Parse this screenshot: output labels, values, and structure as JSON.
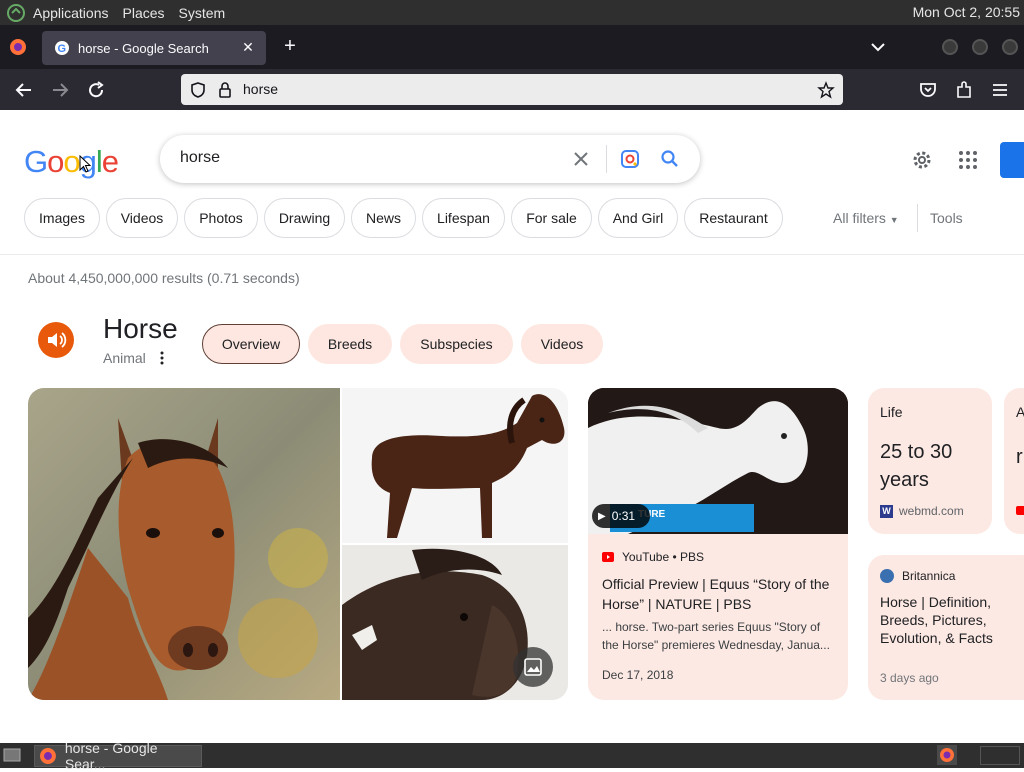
{
  "top_panel": {
    "menus": [
      "Applications",
      "Places",
      "System"
    ],
    "clock": "Mon Oct  2, 20:55"
  },
  "browser": {
    "tab_title": "horse - Google Search",
    "url": "horse"
  },
  "search": {
    "query": "horse",
    "chips": [
      "Images",
      "Videos",
      "Photos",
      "Drawing",
      "News",
      "Lifespan",
      "For sale",
      "And Girl",
      "Restaurant"
    ],
    "all_filters": "All filters",
    "tools": "Tools",
    "stats": "About 4,450,000,000 results (0.71 seconds)"
  },
  "knowledge": {
    "title": "Horse",
    "subtitle": "Animal",
    "tabs": [
      "Overview",
      "Breeds",
      "Subspecies",
      "Videos"
    ]
  },
  "video_card": {
    "duration": "0:31",
    "source": "YouTube • PBS",
    "title": "Official Preview | Equus “Story of the Horse” | NATURE | PBS",
    "snippet": "... horse. Two-part series Equus \"Story of the Horse\" premieres Wednesday, Janua...",
    "date": "Dec 17, 2018"
  },
  "life_card": {
    "label": "Life",
    "value": "25 to 30 years",
    "source": "webmd.com"
  },
  "brit_card": {
    "source": "Britannica",
    "title": "Horse | Definition, Breeds, Pictures, Evolution, & Facts",
    "date": "3 days ago"
  },
  "taskbar": {
    "task": "horse - Google Sear..."
  }
}
